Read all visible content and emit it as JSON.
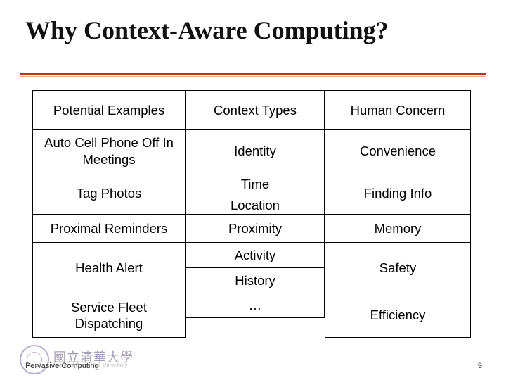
{
  "title": "Why Context-Aware Computing?",
  "columns": {
    "a": {
      "header": "Potential Examples"
    },
    "b": {
      "header": "Context Types"
    },
    "c": {
      "header": "Human Concern"
    }
  },
  "colA": {
    "r1": "Auto Cell Phone Off In Meetings",
    "r2": "Tag Photos",
    "r3": "Proximal Reminders",
    "r4": "Health Alert",
    "r5": "Service Fleet Dispatching"
  },
  "colB": {
    "r1": "Identity",
    "r2": "Time",
    "r3": "Location",
    "r4": "Proximity",
    "r5": "Activity",
    "r6": "History",
    "r7": "…"
  },
  "colC": {
    "r1": "Convenience",
    "r2": "Finding Info",
    "r3": "Memory",
    "r4": "Safety",
    "r5": "Efficiency"
  },
  "footer": {
    "left": "Pervasive Computing",
    "page": "9"
  },
  "logo": {
    "script": "國立清華大學",
    "sub": "National Tsing Hua University"
  }
}
